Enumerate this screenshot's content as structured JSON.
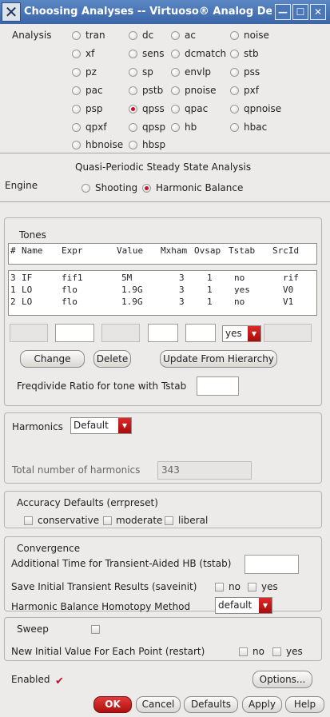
{
  "window": {
    "title": "Choosing Analyses -- Virtuoso® Analog De",
    "app_icon_glyph": "✕",
    "minimize_glyph": "—",
    "maximize_glyph": "☐",
    "close_glyph": "✕"
  },
  "analysis": {
    "label": "Analysis",
    "selected": "qpss",
    "options": [
      [
        "tran",
        "dc",
        "ac",
        "noise"
      ],
      [
        "xf",
        "sens",
        "dcmatch",
        "stb"
      ],
      [
        "pz",
        "sp",
        "envlp",
        "pss"
      ],
      [
        "pac",
        "pstb",
        "pnoise",
        "pxf"
      ],
      [
        "psp",
        "qpss",
        "qpac",
        "qpnoise"
      ],
      [
        "qpxf",
        "qpsp",
        "hb",
        "hbac"
      ],
      [
        "hbnoise",
        "hbsp"
      ]
    ]
  },
  "section_title": "Quasi-Periodic Steady State Analysis",
  "engine": {
    "label": "Engine",
    "options": [
      "Shooting",
      "Harmonic Balance"
    ],
    "selected": "Harmonic Balance"
  },
  "tones": {
    "title": "Tones",
    "columns": [
      "#",
      "Name",
      "Expr",
      "Value",
      "Mxham",
      "Ovsap",
      "Tstab",
      "SrcId"
    ],
    "rows": [
      [
        "3",
        "IF",
        "fif1",
        "5M",
        "3",
        "1",
        "no",
        "rif"
      ],
      [
        "1",
        "LO",
        "flo",
        "1.9G",
        "3",
        "1",
        "yes",
        "V0"
      ],
      [
        "2",
        "LO",
        "flo",
        "1.9G",
        "3",
        "1",
        "no",
        "V1"
      ]
    ],
    "tstab_value": "yes",
    "buttons": {
      "change": "Change",
      "delete": "Delete",
      "update": "Update From Hierarchy"
    },
    "freqdivide_label": "Freqdivide Ratio for tone with Tstab"
  },
  "harmonics": {
    "label": "Harmonics",
    "value": "Default",
    "total_label": "Total number of harmonics",
    "total_value": "343"
  },
  "accuracy": {
    "title": "Accuracy Defaults (errpreset)",
    "options": [
      "conservative",
      "moderate",
      "liberal"
    ]
  },
  "convergence": {
    "title": "Convergence",
    "tstab_label": "Additional Time for Transient-Aided HB (tstab)",
    "saveinit_label": "Save Initial Transient Results (saveinit)",
    "saveinit_options": [
      "no",
      "yes"
    ],
    "homotopy_label": "Harmonic Balance Homotopy Method",
    "homotopy_value": "default"
  },
  "sweep": {
    "label": "Sweep",
    "restart_label": "New Initial Value For Each Point (restart)",
    "restart_options": [
      "no",
      "yes"
    ]
  },
  "enabled": {
    "label": "Enabled",
    "checked": true
  },
  "buttons": {
    "options": "Options...",
    "ok": "OK",
    "cancel": "Cancel",
    "defaults": "Defaults",
    "apply": "Apply",
    "help": "Help"
  }
}
